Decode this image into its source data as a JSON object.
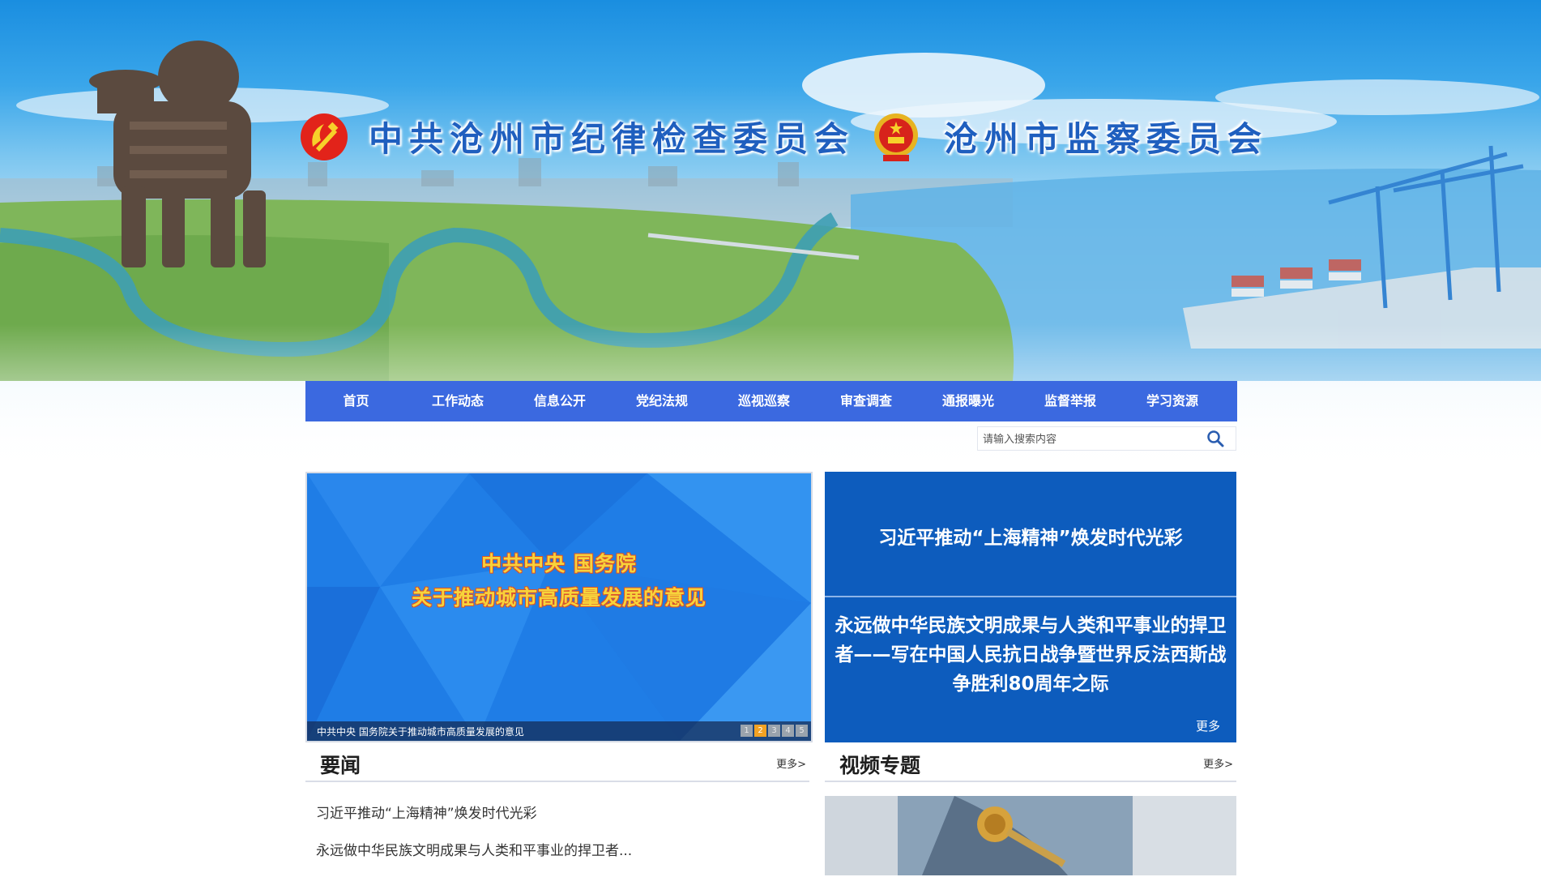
{
  "header": {
    "title_left": "中共沧州市纪律检查委员会",
    "title_right": "沧州市监察委员会"
  },
  "nav": {
    "items": [
      "首页",
      "工作动态",
      "信息公开",
      "党纪法规",
      "巡视巡察",
      "审查调查",
      "通报曝光",
      "监督举报",
      "学习资源"
    ]
  },
  "search": {
    "placeholder": "请输入搜索内容",
    "icon": "search-icon"
  },
  "slider": {
    "headline_line1": "中共中央 国务院",
    "headline_line2": "关于推动城市高质量发展的意见",
    "caption": "中共中央 国务院关于推动城市高质量发展的意见",
    "dots": [
      "1",
      "2",
      "3",
      "4",
      "5"
    ],
    "active_dot": 2
  },
  "headlines": {
    "title1": "习近平推动“上海精神”焕发时代光彩",
    "title2": "永远做中华民族文明成果与人类和平事业的捍卫者——写在中国人民抗日战争暨世界反法西斯战争胜利80周年之际",
    "more": "更多"
  },
  "news": {
    "title": "要闻",
    "more": "更多>",
    "items": [
      "习近平推动“上海精神”焕发时代光彩",
      "永远做中华民族文明成果与人类和平事业的捍卫者..."
    ]
  },
  "video": {
    "title": "视频专题",
    "more": "更多>"
  },
  "colors": {
    "nav_bg": "#3b69e0",
    "headline_bg": "#0d5cbd",
    "title_blue": "#1f5fbf",
    "dot_active": "#f3a223"
  }
}
